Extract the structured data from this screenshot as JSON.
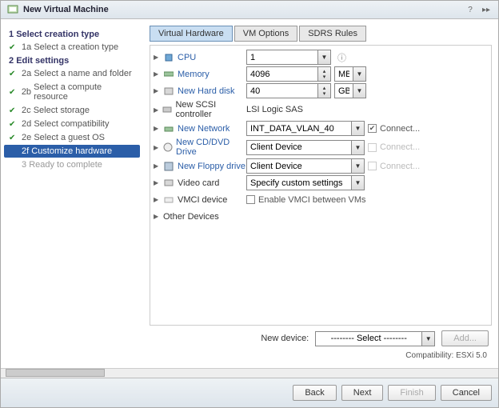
{
  "title": "New Virtual Machine",
  "sidebar": {
    "sections": [
      {
        "num": "1",
        "label": "Select creation type"
      },
      {
        "num": "1a",
        "label": "Select a creation type",
        "done": true
      },
      {
        "num": "2",
        "label": "Edit settings"
      },
      {
        "num": "2a",
        "label": "Select a name and folder",
        "done": true
      },
      {
        "num": "2b",
        "label": "Select a compute resource",
        "done": true
      },
      {
        "num": "2c",
        "label": "Select storage",
        "done": true
      },
      {
        "num": "2d",
        "label": "Select compatibility",
        "done": true
      },
      {
        "num": "2e",
        "label": "Select a guest OS",
        "done": true
      },
      {
        "num": "2f",
        "label": "Customize hardware",
        "active": true
      },
      {
        "num": "3",
        "label": "Ready to complete",
        "muted": true
      }
    ]
  },
  "tabs": [
    "Virtual Hardware",
    "VM Options",
    "SDRS Rules"
  ],
  "hardware": {
    "cpu": {
      "label": "CPU",
      "value": "1"
    },
    "memory": {
      "label": "Memory",
      "value": "4096",
      "unit": "MB"
    },
    "disk": {
      "label": "New Hard disk",
      "value": "40",
      "unit": "GB"
    },
    "scsi": {
      "label": "New SCSI controller",
      "value": "LSI Logic SAS"
    },
    "network": {
      "label": "New Network",
      "value": "INT_DATA_VLAN_40",
      "connect": "Connect...",
      "checked": true
    },
    "cddvd": {
      "label": "New CD/DVD Drive",
      "value": "Client Device",
      "connect": "Connect...",
      "checked": false,
      "disabled": true
    },
    "floppy": {
      "label": "New Floppy drive",
      "value": "Client Device",
      "connect": "Connect...",
      "checked": false,
      "disabled": true
    },
    "video": {
      "label": "Video card",
      "value": "Specify custom settings"
    },
    "vmci": {
      "label": "VMCI device",
      "enable_label": "Enable VMCI between VMs"
    },
    "other": {
      "label": "Other Devices"
    }
  },
  "newdevice": {
    "label": "New device:",
    "placeholder": "-------- Select --------",
    "add": "Add..."
  },
  "compat": "Compatibility: ESXi 5.0",
  "buttons": {
    "back": "Back",
    "next": "Next",
    "finish": "Finish",
    "cancel": "Cancel"
  }
}
